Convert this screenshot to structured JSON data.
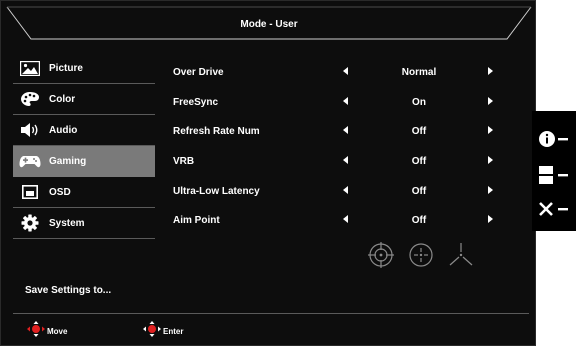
{
  "header": {
    "title": "Mode - User"
  },
  "menu": {
    "items": [
      {
        "label": "Picture",
        "icon": "picture-icon"
      },
      {
        "label": "Color",
        "icon": "palette-icon"
      },
      {
        "label": "Audio",
        "icon": "speaker-icon"
      },
      {
        "label": "Gaming",
        "icon": "gamepad-icon",
        "active": true
      },
      {
        "label": "OSD",
        "icon": "osd-window-icon"
      },
      {
        "label": "System",
        "icon": "gear-icon"
      }
    ],
    "save_label": "Save Settings to..."
  },
  "settings": {
    "rows": [
      {
        "label": "Over Drive",
        "value": "Normal"
      },
      {
        "label": "FreeSync",
        "value": "On"
      },
      {
        "label": "Refresh Rate Num",
        "value": "Off"
      },
      {
        "label": "VRB",
        "value": "Off"
      },
      {
        "label": "Ultra-Low Latency",
        "value": "Off"
      },
      {
        "label": "Aim Point",
        "value": "Off"
      }
    ],
    "aim_point_options": [
      "crosshair-circle-icon",
      "crosshair-dot-icon",
      "crosshair-tri-icon"
    ]
  },
  "footer": {
    "move_label": "Move",
    "enter_label": "Enter"
  },
  "side_buttons": [
    "info-icon",
    "input-icon",
    "close-icon"
  ],
  "colors": {
    "background": "#0d0d0d",
    "active_item": "#7a7a7a",
    "joystick_red": "#e02020"
  }
}
